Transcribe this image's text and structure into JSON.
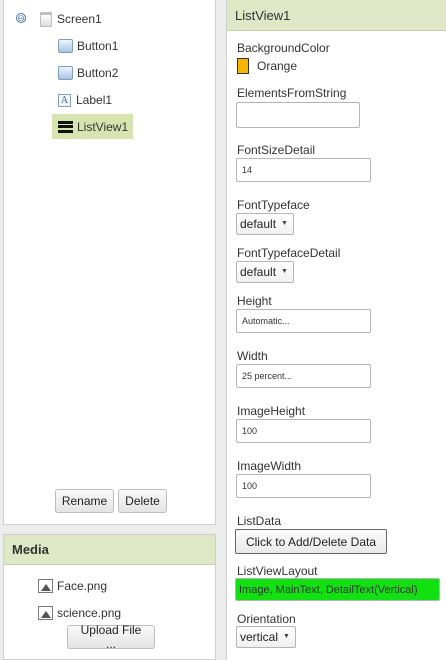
{
  "components": {
    "toggle_symbol": "⊖",
    "tree": [
      {
        "label": "Screen1",
        "icon": "screen-icon"
      },
      {
        "label": "Button1",
        "icon": "button-icon"
      },
      {
        "label": "Button2",
        "icon": "button-icon"
      },
      {
        "label": "Label1",
        "icon": "label-icon",
        "glyph": "A"
      },
      {
        "label": "ListView1",
        "icon": "listview-icon",
        "selected": true
      }
    ],
    "rename_label": "Rename",
    "delete_label": "Delete"
  },
  "media": {
    "title": "Media",
    "files": [
      {
        "name": "Face.png",
        "icon": "image-icon"
      },
      {
        "name": "science.png",
        "icon": "image-icon"
      }
    ],
    "upload_label": "Upload File ..."
  },
  "properties": {
    "title": "ListView1",
    "background_color": {
      "label": "BackgroundColor",
      "value": "Orange",
      "swatch": "#f7b500"
    },
    "elements_from_string": {
      "label": "ElementsFromString",
      "value": ""
    },
    "font_size_detail": {
      "label": "FontSizeDetail",
      "value": "14"
    },
    "font_typeface": {
      "label": "FontTypeface",
      "value": "default"
    },
    "font_typeface_detail": {
      "label": "FontTypefaceDetail",
      "value": "default"
    },
    "height": {
      "label": "Height",
      "value": "Automatic..."
    },
    "width": {
      "label": "Width",
      "value": "25 percent..."
    },
    "image_height": {
      "label": "ImageHeight",
      "value": "100"
    },
    "image_width": {
      "label": "ImageWidth",
      "value": "100"
    },
    "list_data": {
      "label": "ListData",
      "button": "Click to Add/Delete Data"
    },
    "list_view_layout": {
      "label": "ListViewLayout",
      "value": "Image, MainText, DetailText(Vertical)",
      "highlight": "#11e011"
    },
    "orientation": {
      "label": "Orientation",
      "value": "vertical"
    },
    "caret": "▼"
  }
}
